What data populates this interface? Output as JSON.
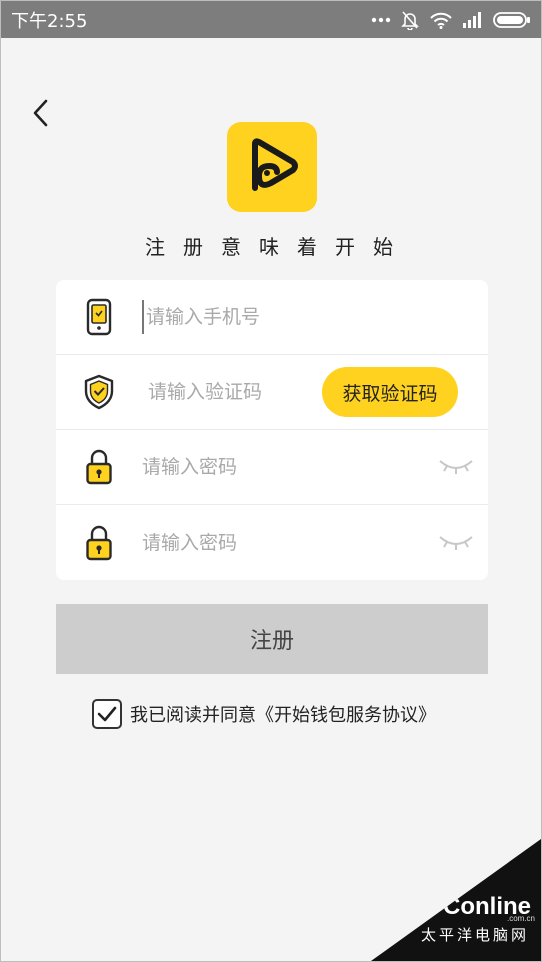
{
  "status_bar": {
    "time": "下午2:55",
    "icons": [
      "more-dots-icon",
      "bell-muted-icon",
      "wifi-icon",
      "signal-icon",
      "battery-icon"
    ]
  },
  "header": {
    "back_icon": "chevron-left-icon",
    "logo_icon": "app-logo-icon",
    "slogan": "注册意味着开始"
  },
  "form": {
    "phone": {
      "icon": "phone-icon",
      "placeholder": "请输入手机号",
      "value": ""
    },
    "code": {
      "icon": "shield-check-icon",
      "placeholder": "请输入验证码",
      "value": "",
      "button_label": "获取验证码"
    },
    "password": {
      "icon": "lock-icon",
      "placeholder": "请输入密码",
      "value": "",
      "toggle_icon": "eye-closed-icon"
    },
    "confirm_password": {
      "icon": "lock-icon",
      "placeholder": "请输入密码",
      "value": "",
      "toggle_icon": "eye-closed-icon"
    }
  },
  "register_button": {
    "label": "注册"
  },
  "agreement": {
    "checked": true,
    "text": "我已阅读并同意《开始钱包服务协议》"
  },
  "watermark": {
    "brand": "PConline",
    "domain": ".com.cn",
    "subtitle": "太平洋电脑网"
  },
  "colors": {
    "accent": "#ffd21f",
    "button_disabled": "#cdcdcd",
    "background": "#f4f4f4",
    "status_bar": "#7d7d7d"
  }
}
